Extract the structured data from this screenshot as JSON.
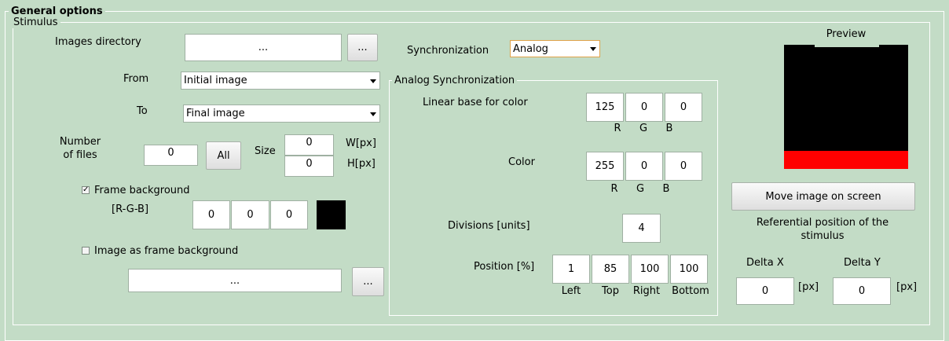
{
  "general_options": {
    "title": "General options",
    "stimulus": {
      "title": "Stimulus",
      "images_directory": {
        "label": "Images directory",
        "value": "...",
        "browse": "..."
      },
      "from": {
        "label": "From",
        "value": "Initial image"
      },
      "to": {
        "label": "To",
        "value": "Final image"
      },
      "number_of_files": {
        "label_line1": "Number",
        "label_line2": "of files",
        "value": "0",
        "all_button": "All"
      },
      "size": {
        "label": "Size",
        "w_value": "0",
        "h_value": "0",
        "w_unit": "W[px]",
        "h_unit": "H[px]"
      },
      "frame_background": {
        "label": "Frame background",
        "checked": true,
        "rgb_label": "[R-G-B]",
        "r": "0",
        "g": "0",
        "b": "0",
        "swatch_color": "#000000"
      },
      "image_as_frame_background": {
        "label": "Image as frame background",
        "checked": false,
        "value": "...",
        "browse": "..."
      },
      "synchronization": {
        "label": "Synchronization",
        "value": "Analog"
      },
      "analog_sync": {
        "title": "Analog Synchronization",
        "linear_base": {
          "label": "Linear base for color",
          "r": "125",
          "g": "0",
          "b": "0"
        },
        "color": {
          "label": "Color",
          "r": "255",
          "g": "0",
          "b": "0"
        },
        "rgb_labels": {
          "r": "R",
          "g": "G",
          "b": "B"
        },
        "divisions": {
          "label": "Divisions [units]",
          "value": "4"
        },
        "position": {
          "label": "Position [%]",
          "left": "1",
          "top": "85",
          "right": "100",
          "bottom": "100",
          "left_label": "Left",
          "top_label": "Top",
          "right_label": "Right",
          "bottom_label": "Bottom"
        }
      },
      "preview": {
        "title": "Preview",
        "move_button": "Move image on screen",
        "referential_line1": "Referential position of the",
        "referential_line2": "stimulus",
        "delta_x": {
          "label": "Delta X",
          "value": "0",
          "unit": "[px]"
        },
        "delta_y": {
          "label": "Delta Y",
          "value": "0",
          "unit": "[px]"
        },
        "bg_color": "#000000",
        "bar_color": "#ff0000"
      }
    }
  }
}
